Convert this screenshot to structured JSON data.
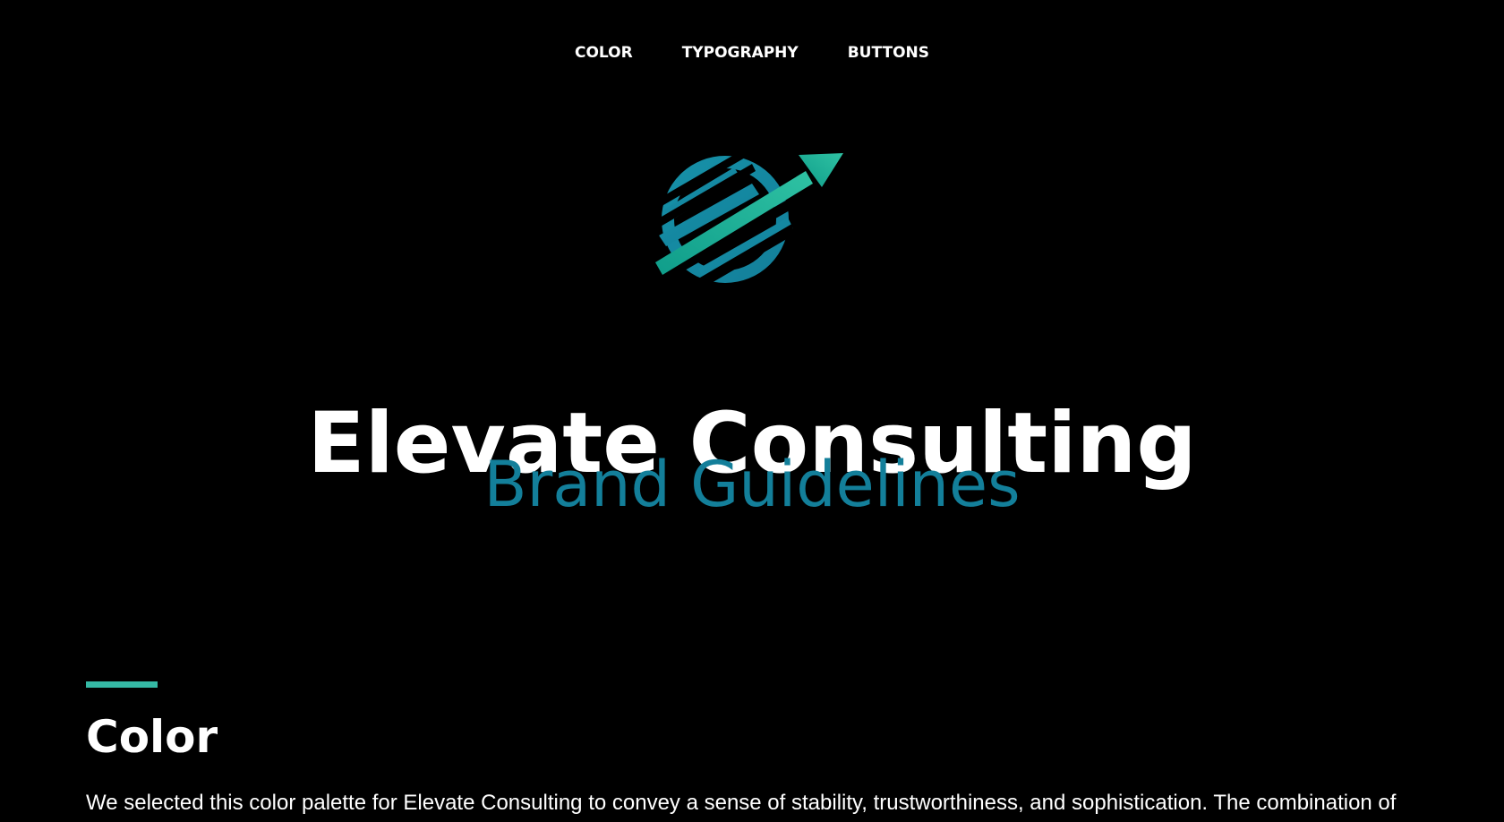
{
  "nav": {
    "items": [
      {
        "label": "COLOR"
      },
      {
        "label": "TYPOGRAPHY"
      },
      {
        "label": "BUTTONS"
      }
    ]
  },
  "hero": {
    "title": "Elevate Consulting",
    "subtitle": "Brand Guidelines"
  },
  "section": {
    "title": "Color",
    "body": "We selected this color palette for Elevate Consulting to convey a sense of stability, trustworthiness, and sophistication. The combination of"
  },
  "colors": {
    "background": "#000000",
    "text": "#ffffff",
    "brand_blue": "#137f9a",
    "accent_teal": "#35b9a5",
    "logo_green": "#13b18a"
  },
  "icons": {
    "logo": "elevate-logo-arrow-globe-icon"
  }
}
